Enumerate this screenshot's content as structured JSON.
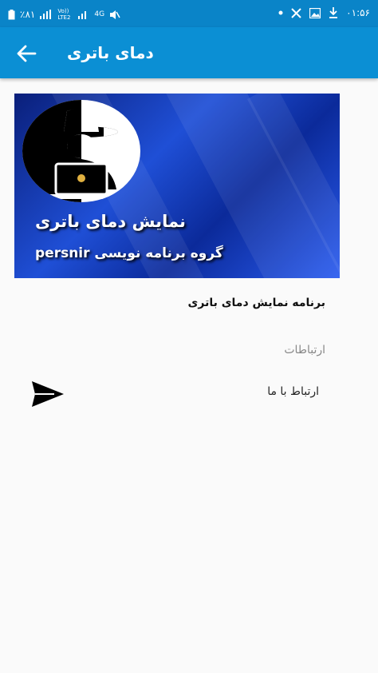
{
  "status_bar": {
    "battery": "٪۸۱",
    "network_volte": "Vo)) LTE2",
    "network_4g": "4G",
    "time": "۰۱:۵۶"
  },
  "app_bar": {
    "title": "دمای باتری"
  },
  "banner": {
    "title": "نمایش دمای باتری",
    "subtitle": "گروه برنامه نویسی persnir"
  },
  "description": "برنامه نمایش دمای باتری",
  "section": {
    "header": "ارتباطات"
  },
  "contact": {
    "label": "ارتباط با ما"
  },
  "colors": {
    "status_bar": "#0a84c8",
    "app_bar": "#0b8fd4",
    "background": "#fafafa"
  },
  "icons": {
    "back": "arrow-left-icon",
    "send": "send-icon"
  }
}
